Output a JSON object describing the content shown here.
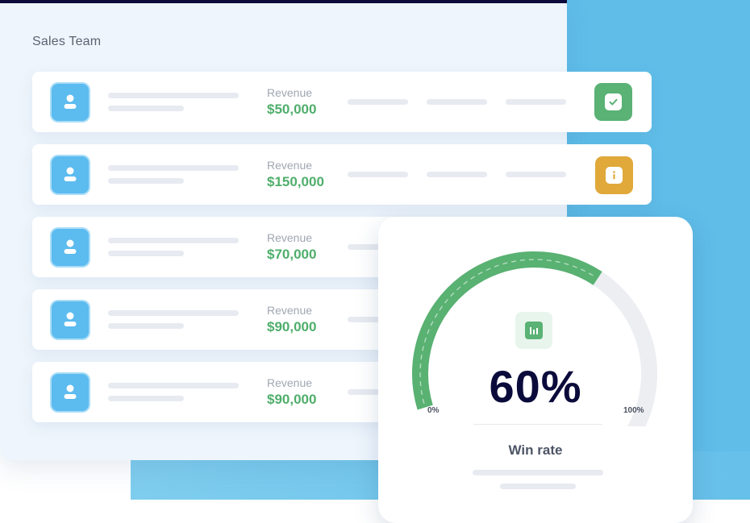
{
  "panel": {
    "title": "Sales Team"
  },
  "rows": [
    {
      "revenue_label": "Revenue",
      "revenue_value": "$50,000",
      "status": "approved",
      "status_icon": "check-icon",
      "status_color": "#5ab275"
    },
    {
      "revenue_label": "Revenue",
      "revenue_value": "$150,000",
      "status": "info",
      "status_icon": "info-icon",
      "status_color": "#e0a93a"
    },
    {
      "revenue_label": "Revenue",
      "revenue_value": "$70,000"
    },
    {
      "revenue_label": "Revenue",
      "revenue_value": "$90,000"
    },
    {
      "revenue_label": "Revenue",
      "revenue_value": "$90,000"
    }
  ],
  "gauge": {
    "value_text": "60%",
    "value": 0.6,
    "min_label": "0%",
    "max_label": "100%",
    "label": "Win rate",
    "icon": "bar-chart-icon",
    "fill_color": "#59b172",
    "track_color": "#eceef2"
  },
  "colors": {
    "accent_blue": "#5fbde8",
    "revenue_green": "#4fae6b",
    "dark_text": "#0b0b3b"
  }
}
